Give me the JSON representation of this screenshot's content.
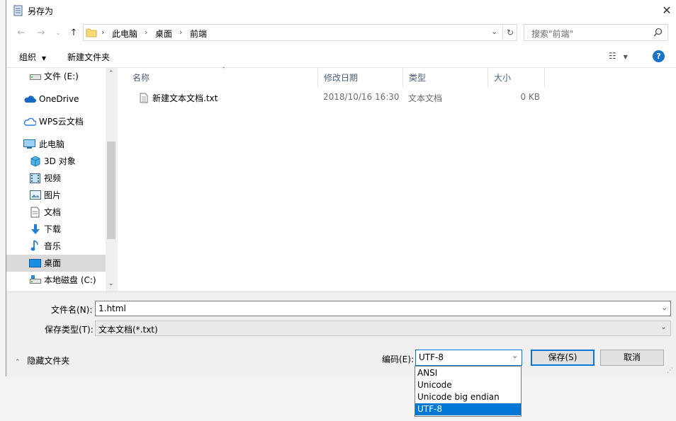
{
  "window": {
    "title": "另存为"
  },
  "address": {
    "crumbs": [
      "此电脑",
      "桌面",
      "前端"
    ],
    "search_placeholder": "搜索\"前端\""
  },
  "toolbar": {
    "organize": "组织",
    "new_folder": "新建文件夹"
  },
  "nav": {
    "items": [
      {
        "label": "文件 (E:)",
        "icon": "drive-icon"
      },
      {
        "label": "OneDrive",
        "icon": "cloud-icon"
      },
      {
        "label": "WPS云文档",
        "icon": "cloud-outline-icon"
      },
      {
        "label": "此电脑",
        "icon": "computer-icon"
      },
      {
        "label": "3D 对象",
        "icon": "cube-icon"
      },
      {
        "label": "视频",
        "icon": "video-icon"
      },
      {
        "label": "图片",
        "icon": "picture-icon"
      },
      {
        "label": "文档",
        "icon": "document-icon"
      },
      {
        "label": "下载",
        "icon": "download-icon"
      },
      {
        "label": "音乐",
        "icon": "music-icon"
      },
      {
        "label": "桌面",
        "icon": "desktop-icon",
        "selected": true
      },
      {
        "label": "本地磁盘 (C:)",
        "icon": "disk-icon"
      }
    ]
  },
  "columns": {
    "name": "名称",
    "modified": "修改日期",
    "type": "类型",
    "size": "大小"
  },
  "files": [
    {
      "name": "新建文本文档.txt",
      "modified": "2018/10/16 16:30",
      "type": "文本文档",
      "size": "0 KB"
    }
  ],
  "form": {
    "filename_label": "文件名(N):",
    "filename_value": "1.html",
    "filetype_label": "保存类型(T):",
    "filetype_value": "文本文档(*.txt)",
    "hide_folders": "隐藏文件夹",
    "encoding_label": "编码(E):",
    "encoding_value": "UTF-8",
    "save": "保存(S)",
    "cancel": "取消"
  },
  "encoding_options": [
    "ANSI",
    "Unicode",
    "Unicode big endian",
    "UTF-8"
  ],
  "colors": {
    "accent": "#0078d7",
    "selection": "#d9d9d9",
    "help": "#1874c8"
  }
}
